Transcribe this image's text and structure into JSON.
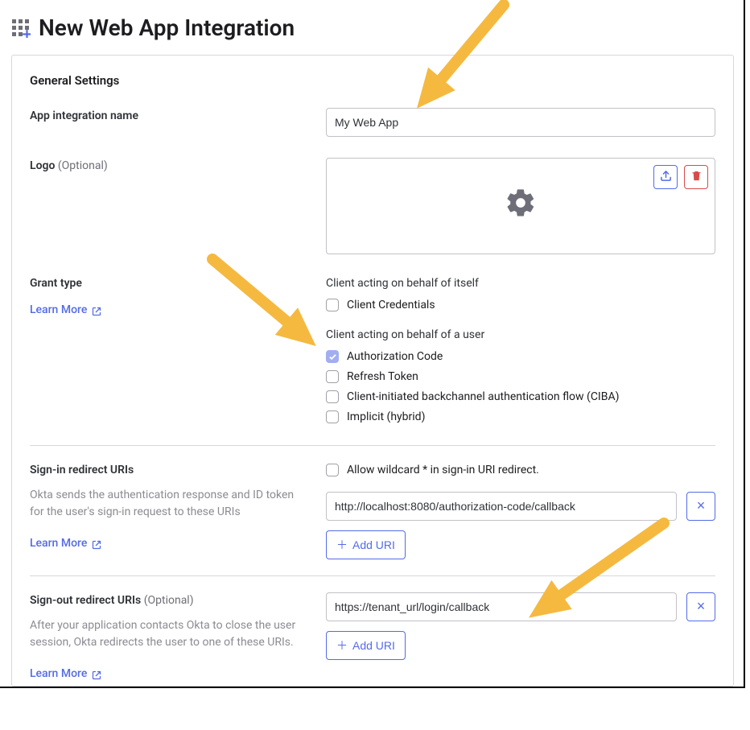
{
  "page": {
    "title": "New Web App Integration"
  },
  "general": {
    "section_title": "General Settings",
    "app_name": {
      "label": "App integration name",
      "value": "My Web App"
    },
    "logo": {
      "label": "Logo",
      "optional": "(Optional)"
    },
    "grant_type": {
      "label": "Grant type",
      "learn_more": "Learn More",
      "self_heading": "Client acting on behalf of itself",
      "user_heading": "Client acting on behalf of a user",
      "options": {
        "client_credentials": {
          "label": "Client Credentials",
          "checked": false
        },
        "authorization_code": {
          "label": "Authorization Code",
          "checked": true
        },
        "refresh_token": {
          "label": "Refresh Token",
          "checked": false
        },
        "ciba": {
          "label": "Client-initiated backchannel authentication flow (CIBA)",
          "checked": false
        },
        "implicit": {
          "label": "Implicit (hybrid)",
          "checked": false
        }
      }
    },
    "signin": {
      "label": "Sign-in redirect URIs",
      "help": "Okta sends the authentication response and ID token for the user's sign-in request to these URIs",
      "learn_more": "Learn More",
      "wildcard_label": "Allow wildcard * in sign-in URI redirect.",
      "wildcard_checked": false,
      "uris": [
        "http://localhost:8080/authorization-code/callback"
      ],
      "add_label": "Add URI"
    },
    "signout": {
      "label": "Sign-out redirect URIs",
      "optional": "(Optional)",
      "help": "After your application contacts Okta to close the user session, Okta redirects the user to one of these URIs.",
      "learn_more": "Learn More",
      "uris": [
        "https://tenant_url/login/callback"
      ],
      "add_label": "Add URI"
    }
  }
}
